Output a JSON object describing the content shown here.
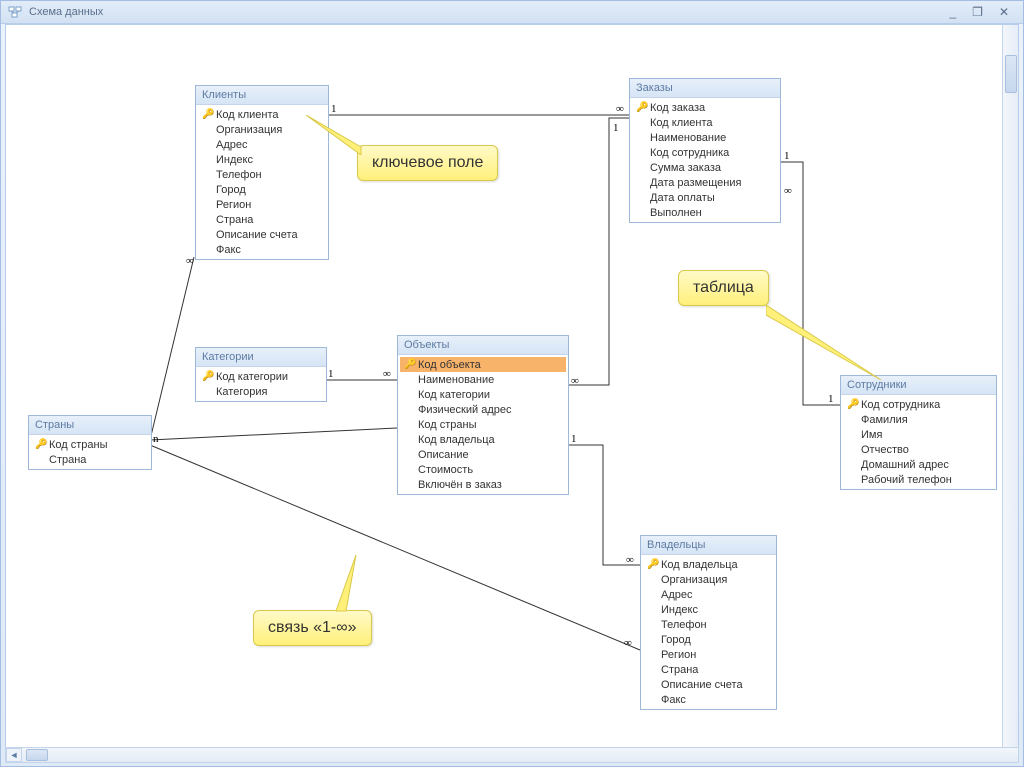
{
  "window": {
    "title": "Схема данных",
    "minimize": "_",
    "restore": "❐",
    "close": "✕"
  },
  "callouts": {
    "key_field": "ключевое поле",
    "table": "таблица",
    "relation": "связь «1-∞»"
  },
  "relations": {
    "one": "1",
    "many": "∞",
    "n": "n"
  },
  "tables": {
    "clients": {
      "title": "Клиенты",
      "f0": "Код клиента",
      "f1": "Организация",
      "f2": "Адрес",
      "f3": "Индекс",
      "f4": "Телефон",
      "f5": "Город",
      "f6": "Регион",
      "f7": "Страна",
      "f8": "Описание счета",
      "f9": "Факс"
    },
    "orders": {
      "title": "Заказы",
      "f0": "Код заказа",
      "f1": "Код клиента",
      "f2": "Наименование",
      "f3": "Код сотрудника",
      "f4": "Сумма заказа",
      "f5": "Дата размещения",
      "f6": "Дата оплаты",
      "f7": "Выполнен"
    },
    "categories": {
      "title": "Категории",
      "f0": "Код категории",
      "f1": "Категория"
    },
    "objects": {
      "title": "Объекты",
      "f0": "Код объекта",
      "f1": "Наименование",
      "f2": "Код категории",
      "f3": "Физический адрес",
      "f4": "Код страны",
      "f5": "Код владельца",
      "f6": "Описание",
      "f7": "Стоимость",
      "f8": "Включён в заказ"
    },
    "countries": {
      "title": "Страны",
      "f0": "Код страны",
      "f1": "Страна"
    },
    "employees": {
      "title": "Сотрудники",
      "f0": "Код сотрудника",
      "f1": "Фамилия",
      "f2": "Имя",
      "f3": "Отчество",
      "f4": "Домашний адрес",
      "f5": "Рабочий телефон"
    },
    "owners": {
      "title": "Владельцы",
      "f0": "Код владельца",
      "f1": "Организация",
      "f2": "Адрес",
      "f3": "Индекс",
      "f4": "Телефон",
      "f5": "Город",
      "f6": "Регион",
      "f7": "Страна",
      "f8": "Описание счета",
      "f9": "Факс"
    }
  }
}
